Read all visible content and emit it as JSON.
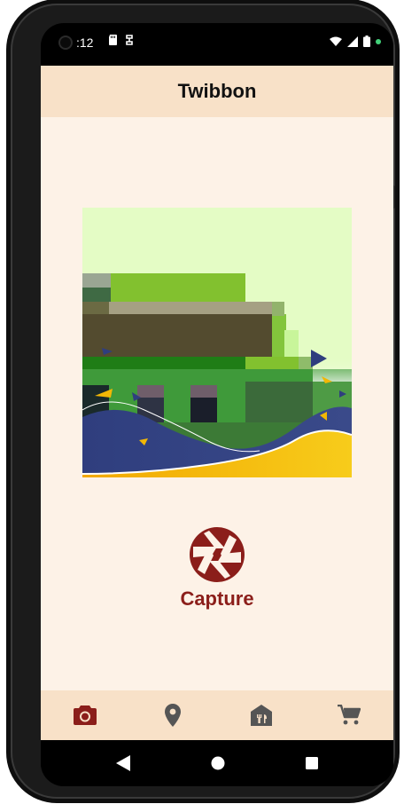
{
  "status_bar": {
    "time": ":12",
    "icons_left": [
      "sd-card-icon",
      "notification-icon"
    ],
    "icons_right": [
      "wifi-icon",
      "signal-icon",
      "battery-icon"
    ]
  },
  "app_bar": {
    "title": "Twibbon"
  },
  "preview": {
    "description_icon": "twibbon-frame-image"
  },
  "capture": {
    "label": "Capture",
    "icon": "camera-shutter-icon",
    "color": "#8b1e1a"
  },
  "bottom_nav": {
    "items": [
      {
        "name": "camera",
        "icon": "camera-icon",
        "active": true,
        "color": "#8b1e1a"
      },
      {
        "name": "location",
        "icon": "location-pin-icon",
        "active": false,
        "color": "#555555"
      },
      {
        "name": "store",
        "icon": "restaurant-store-icon",
        "active": false,
        "color": "#555555"
      },
      {
        "name": "cart",
        "icon": "cart-icon",
        "active": false,
        "color": "#555555"
      }
    ]
  },
  "colors": {
    "app_bar_bg": "#f8e1c8",
    "content_bg": "#fdf2e7",
    "accent": "#8b1e1a"
  }
}
